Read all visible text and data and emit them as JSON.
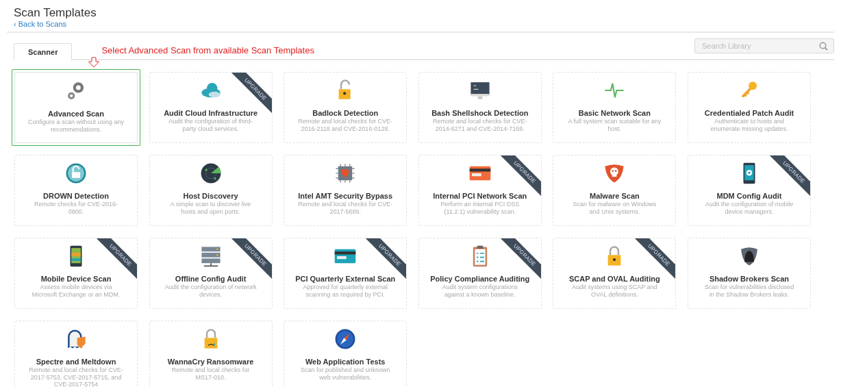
{
  "header": {
    "title": "Scan Templates",
    "back_link": "‹ Back to Scans"
  },
  "tabs": [
    {
      "label": "Scanner",
      "selected": true
    }
  ],
  "annotation": {
    "text": "Select Advanced Scan from available Scan Templates"
  },
  "search": {
    "placeholder": "Search Library"
  },
  "templates": [
    {
      "title": "Advanced Scan",
      "description": "Configure a scan without using any recommendations.",
      "selected": true
    },
    {
      "title": "Audit Cloud Infrastructure",
      "description": "Audit the configuration of third-party cloud services.",
      "selected": false,
      "ribbon": "UPGRADE"
    },
    {
      "title": "Badlock Detection",
      "description": "Remote and local checks for CVE-2016-2118 and CVE-2016-0128.",
      "selected": false
    },
    {
      "title": "Bash Shellshock Detection",
      "description": "Remote and local checks for CVE-2014-6271 and CVE-2014-7169.",
      "selected": false
    },
    {
      "title": "Basic Network Scan",
      "description": "A full system scan suitable for any host.",
      "selected": false
    },
    {
      "title": "Credentialed Patch Audit",
      "description": "Authenticate to hosts and enumerate missing updates.",
      "selected": false
    },
    {
      "title": "DROWN Detection",
      "description": "Remote checks for CVE-2016-0800.",
      "selected": false
    },
    {
      "title": "Host Discovery",
      "description": "A simple scan to discover live hosts and open ports.",
      "selected": false
    },
    {
      "title": "Intel AMT Security Bypass",
      "description": "Remote and local checks for CVE-2017-5689.",
      "selected": false
    },
    {
      "title": "Internal PCI Network Scan",
      "description": "Perform an internal PCI DSS (11.2.1) vulnerability scan.",
      "selected": false,
      "ribbon": "UPGRADE"
    },
    {
      "title": "Malware Scan",
      "description": "Scan for malware on Windows and Unix systems.",
      "selected": false
    },
    {
      "title": "MDM Config Audit",
      "description": "Audit the configuration of mobile device managers.",
      "selected": false,
      "ribbon": "UPGRADE"
    },
    {
      "title": "Mobile Device Scan",
      "description": "Assess mobile devices via Microsoft Exchange or an MDM.",
      "selected": false,
      "ribbon": "UPGRADE"
    },
    {
      "title": "Offline Config Audit",
      "description": "Audit the configuration of network devices.",
      "selected": false,
      "ribbon": "UPGRADE"
    },
    {
      "title": "PCI Quarterly External Scan",
      "description": "Approved for quarterly external scanning as required by PCI.",
      "selected": false,
      "ribbon": "UPGRADE"
    },
    {
      "title": "Policy Compliance Auditing",
      "description": "Audit system configurations against a known baseline.",
      "selected": false,
      "ribbon": "UPGRADE"
    },
    {
      "title": "SCAP and OVAL Auditing",
      "description": "Audit systems using SCAP and OVAL definitions.",
      "selected": false,
      "ribbon": "UPGRADE"
    },
    {
      "title": "Shadow Brokers Scan",
      "description": "Scan for vulnerabilities disclosed in the Shadow Brokers leaks.",
      "selected": false
    },
    {
      "title": "Spectre and Meltdown",
      "description": "Remote and local checks for CVE-2017-5753, CVE-2017-5715, and CVE-2017-5754",
      "selected": false
    },
    {
      "title": "WannaCry Ransomware",
      "description": "Remote and local checks for MS17-010.",
      "selected": false
    },
    {
      "title": "Web Application Tests",
      "description": "Scan for published and unknown web vulnerabilities.",
      "selected": false
    }
  ]
}
